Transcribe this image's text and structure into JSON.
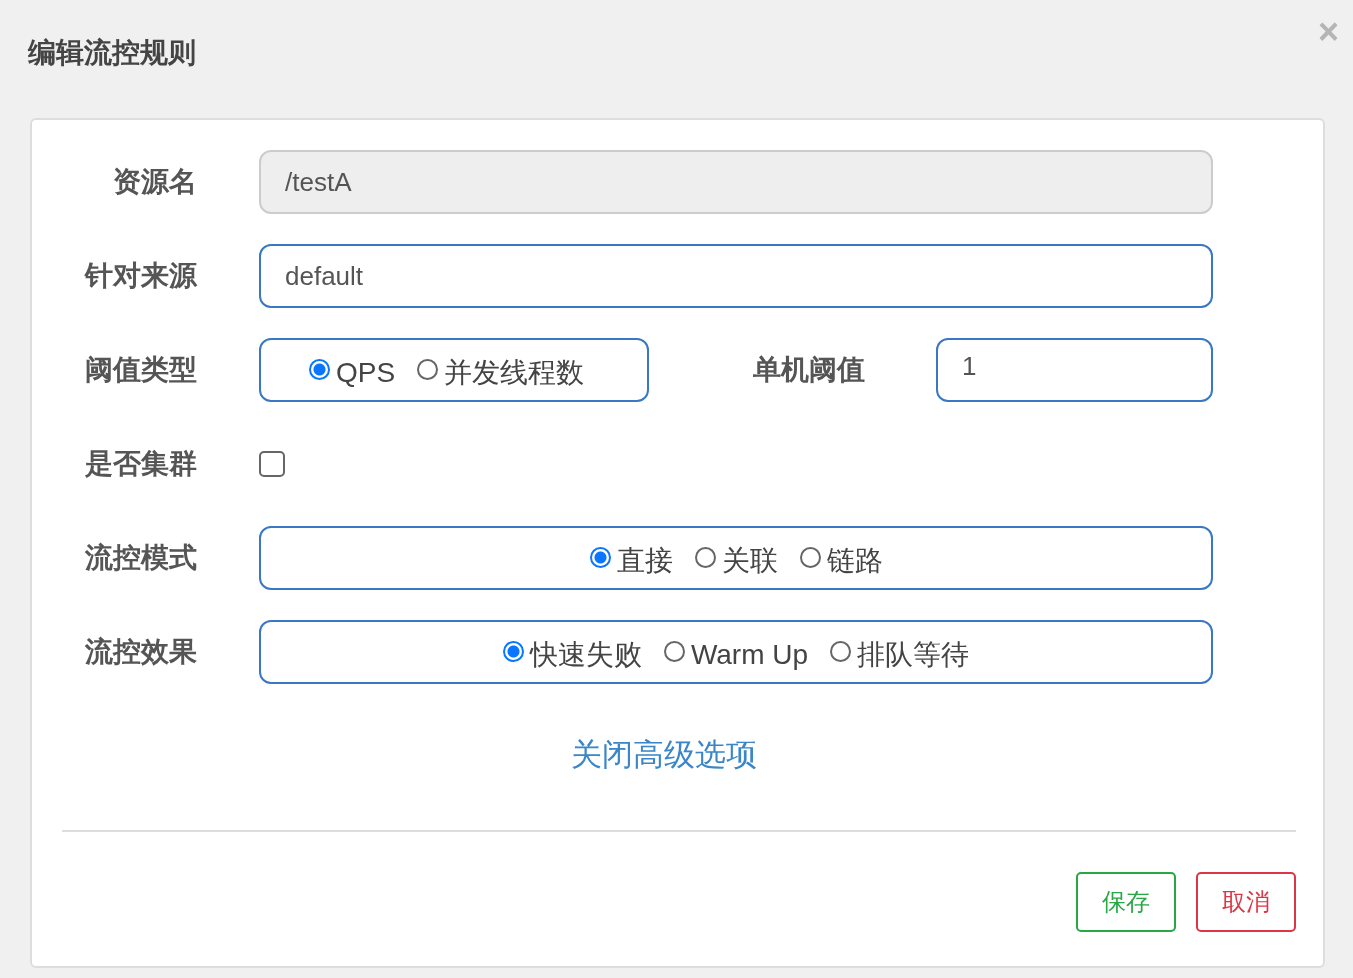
{
  "dialog": {
    "title": "编辑流控规则",
    "close": "×"
  },
  "resource": {
    "label": "资源名",
    "value": "/testA",
    "disabled": true
  },
  "origin": {
    "label": "针对来源",
    "value": "default",
    "disabled": false
  },
  "threshold_type": {
    "label": "阈值类型",
    "options": [
      {
        "label": "QPS",
        "selected": true
      },
      {
        "label": "并发线程数",
        "selected": false
      }
    ]
  },
  "threshold": {
    "label": "单机阈值",
    "value": "1"
  },
  "cluster": {
    "label": "是否集群",
    "checked": false
  },
  "mode": {
    "label": "流控模式",
    "options": [
      {
        "label": "直接",
        "selected": true
      },
      {
        "label": "关联",
        "selected": false
      },
      {
        "label": "链路",
        "selected": false
      }
    ]
  },
  "effect": {
    "label": "流控效果",
    "options": [
      {
        "label": "快速失败",
        "selected": true
      },
      {
        "label": "Warm Up",
        "selected": false
      },
      {
        "label": "排队等待",
        "selected": false
      }
    ]
  },
  "advanced_link": "关闭高级选项",
  "buttons": [
    {
      "label": "保存",
      "kind": "save"
    },
    {
      "label": "取消",
      "kind": "cancel"
    }
  ]
}
